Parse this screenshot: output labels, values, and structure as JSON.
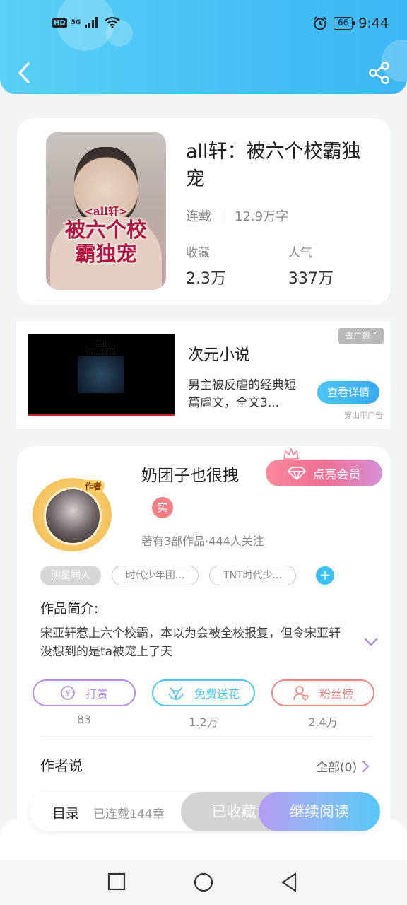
{
  "status_bar": {
    "hd": "HD",
    "network": "5G",
    "battery": "66",
    "time": "9:44"
  },
  "book": {
    "title": "all轩：被六个校霸独宠",
    "status": "连载",
    "word_count": "12.9万字",
    "favorites_label": "收藏",
    "favorites_value": "2.3万",
    "popularity_label": "人气",
    "popularity_value": "337万",
    "cover_text_top": "<all轩>",
    "cover_text_main": "被六个校霸独宠"
  },
  "ad": {
    "title": "次元小说",
    "description": "男主被反虐的经典短篇虐文，全文3...",
    "remove_label": "去广告",
    "cta_label": "查看详情",
    "source": "穿山甲广告"
  },
  "author": {
    "name": "奶团子也很拽",
    "avatar_badge": "作者",
    "vip_button": "点亮会员",
    "real_badge": "实",
    "stats": "著有3部作品·444人关注",
    "tags": [
      "明星同人",
      "时代少年团...",
      "TNT时代少..."
    ],
    "add_tag": "+"
  },
  "intro": {
    "label": "作品简介:",
    "text": "宋亚轩惹上六个校霸，本以为会被全校报复，但令宋亚轩没想到的是ta被宠上了天"
  },
  "actions": [
    {
      "label": "打赏",
      "count": "83",
      "color": "#b48be6",
      "icon": "reward-icon"
    },
    {
      "label": "免费送花",
      "count": "1.2万",
      "color": "#48c4ef",
      "icon": "flower-icon"
    },
    {
      "label": "粉丝榜",
      "count": "2.4万",
      "color": "#ee8585",
      "icon": "fans-icon"
    }
  ],
  "author_says": {
    "label": "作者说",
    "all_label": "全部(0)"
  },
  "bottom_bar": {
    "toc_label": "目录",
    "chapter_count": "已连载144章",
    "collected_label": "已收藏",
    "continue_label": "继续阅读"
  },
  "colors": {
    "header_blue": "#45bff5",
    "accent_pink": "#ee6f93",
    "accent_purple": "#b48be6"
  }
}
